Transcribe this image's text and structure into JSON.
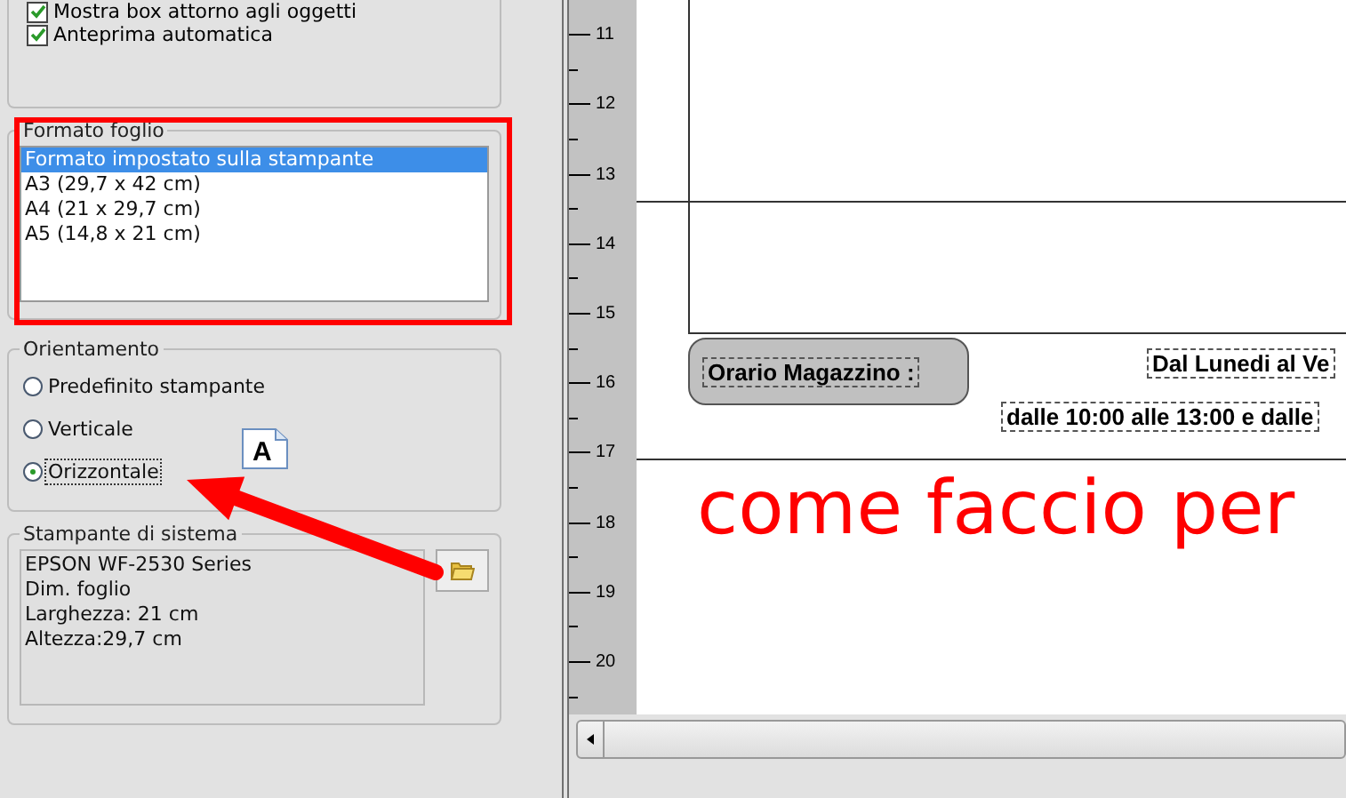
{
  "options": [
    {
      "label": "Mostra box attorno agli oggetti",
      "checked": true
    },
    {
      "label": "Anteprima automatica",
      "checked": true
    }
  ],
  "sheet_format": {
    "title": "Formato foglio",
    "items": [
      {
        "label": "Formato impostato sulla stampante",
        "selected": true
      },
      {
        "label": "A3 (29,7 x 42 cm)",
        "selected": false
      },
      {
        "label": "A4 (21 x 29,7 cm)",
        "selected": false
      },
      {
        "label": "A5 (14,8 x 21 cm)",
        "selected": false
      }
    ]
  },
  "orientation": {
    "title": "Orientamento",
    "options": [
      {
        "label": "Predefinito stampante",
        "selected": false
      },
      {
        "label": "Verticale",
        "selected": false
      },
      {
        "label": "Orizzontale",
        "selected": true
      }
    ],
    "icon_letter": "A"
  },
  "system_printer": {
    "title": "Stampante di sistema",
    "lines": [
      "EPSON WF-2530 Series",
      "Dim. foglio",
      "Larghezza: 21 cm",
      "Altezza:29,7 cm"
    ]
  },
  "ruler": {
    "labels": [
      "11",
      "12",
      "13",
      "14",
      "15",
      "16",
      "17",
      "18",
      "19",
      "20"
    ]
  },
  "page": {
    "header_box": "Orario Magazzino :",
    "texts": [
      "Dal Lunedi al Ve",
      "dalle 10:00 alle 13:00 e dalle"
    ]
  },
  "annotation": {
    "text": "come faccio per"
  }
}
